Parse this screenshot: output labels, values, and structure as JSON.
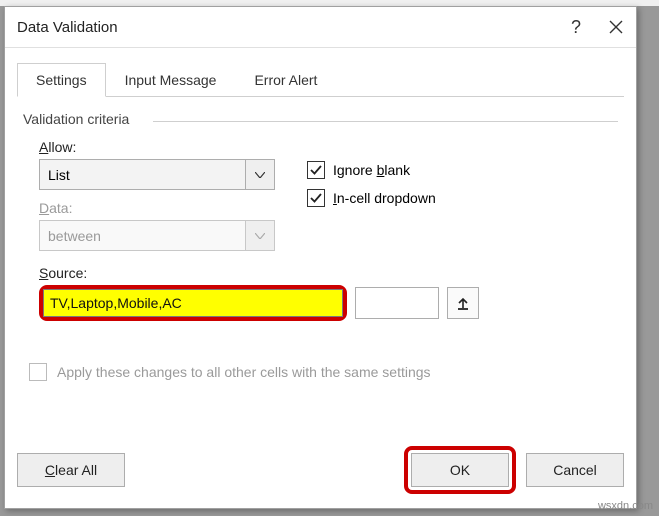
{
  "dialog": {
    "title": "Data Validation",
    "help": "?",
    "tabs": {
      "settings": "Settings",
      "input_message": "Input Message",
      "error_alert": "Error Alert"
    },
    "fieldset": "Validation criteria",
    "allow": {
      "label": "Allow:",
      "value": "List"
    },
    "data": {
      "label": "Data:",
      "value": "between"
    },
    "checks": {
      "ignore_blank": "Ignore blank",
      "in_cell_dropdown": "In-cell dropdown"
    },
    "source": {
      "label": "Source:",
      "value": "TV,Laptop,Mobile,AC"
    },
    "apply": "Apply these changes to all other cells with the same settings",
    "buttons": {
      "clear_all": "Clear All",
      "ok": "OK",
      "cancel": "Cancel"
    }
  },
  "watermark": "wsxdn.com"
}
